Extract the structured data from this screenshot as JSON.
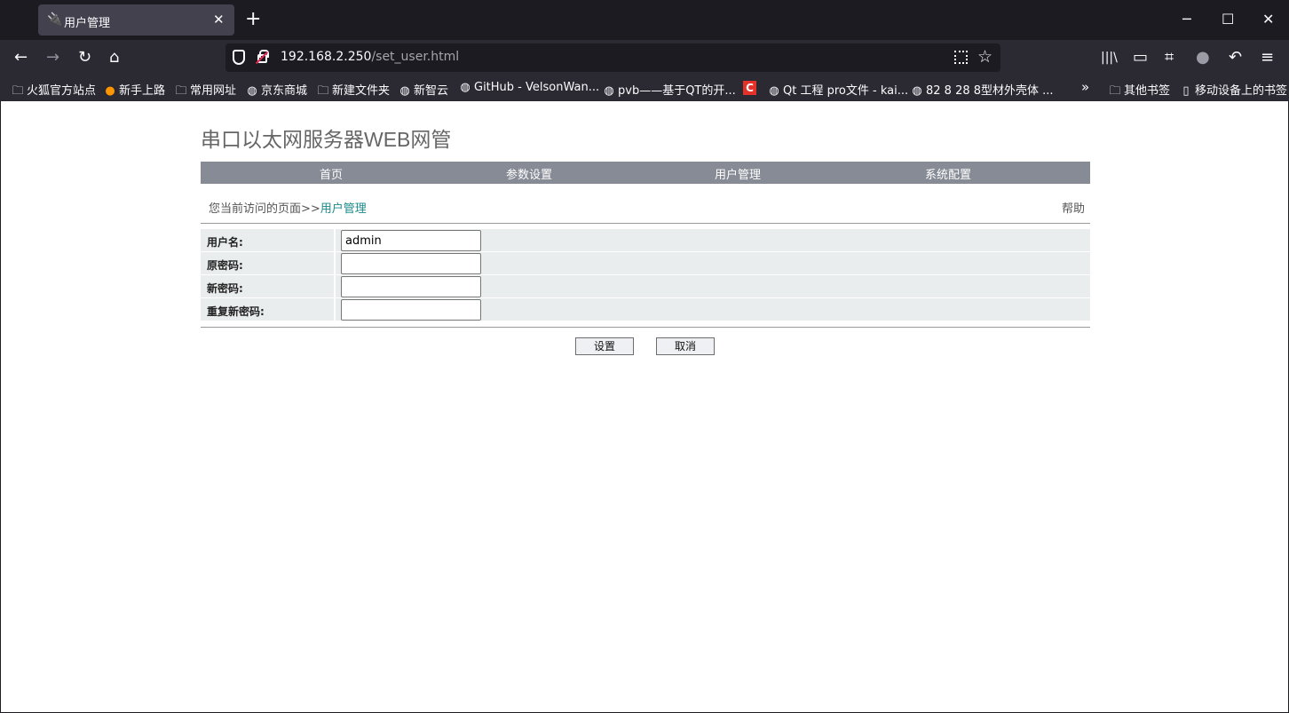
{
  "browser": {
    "tab_title": "用户管理",
    "url_host": "192.168.2.250",
    "url_path": "/set_user.html",
    "bookmarks": [
      {
        "label": "火狐官方站点",
        "icon": "folder-icon"
      },
      {
        "label": "新手上路",
        "icon": "firefox-icon"
      },
      {
        "label": "常用网址",
        "icon": "folder-icon"
      },
      {
        "label": "京东商城",
        "icon": "globe-icon"
      },
      {
        "label": "新建文件夹",
        "icon": "folder-icon"
      },
      {
        "label": "新智云",
        "icon": "globe-icon"
      },
      {
        "label": "GitHub - VelsonWan...",
        "icon": "globe-icon"
      },
      {
        "label": "pvb——基于QT的开...",
        "icon": "globe-icon"
      },
      {
        "label": "",
        "icon": "csdn-icon"
      },
      {
        "label": "Qt 工程 pro文件 - kai...",
        "icon": "globe-icon"
      },
      {
        "label": "82 8 28 8型材外壳体 ...",
        "icon": "globe-icon"
      }
    ],
    "other_bookmarks": "其他书签",
    "mobile_bookmarks": "移动设备上的书签"
  },
  "page": {
    "title": "串口以太网服务器WEB网管",
    "menu": [
      "首页",
      "参数设置",
      "用户管理",
      "系统配置"
    ],
    "breadcrumb_prefix": "您当前访问的页面>>",
    "breadcrumb_current": "用户管理",
    "help": "帮助",
    "form": {
      "username_label": "用户名:",
      "username_value": "admin",
      "old_password_label": "原密码:",
      "new_password_label": "新密码:",
      "repeat_password_label": "重复新密码:"
    },
    "submit_label": "设置",
    "cancel_label": "取消"
  }
}
